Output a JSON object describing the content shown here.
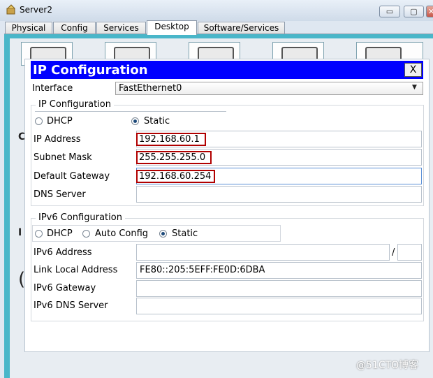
{
  "window": {
    "title": "Server2",
    "min_label": "▭",
    "max_label": "▢",
    "close_label": "✕"
  },
  "tabs": [
    {
      "label": "Physical"
    },
    {
      "label": "Config"
    },
    {
      "label": "Services"
    },
    {
      "label": "Desktop"
    },
    {
      "label": "Software/Services"
    }
  ],
  "background_letters": [
    "C",
    "I",
    "("
  ],
  "dialog": {
    "title": "IP Configuration",
    "close_label": "X",
    "interface_label": "Interface",
    "interface_value": "FastEthernet0",
    "ipv4": {
      "group_title": "IP Configuration",
      "dhcp_label": "DHCP",
      "static_label": "Static",
      "ip_label": "IP Address",
      "ip_value": "192.168.60.1",
      "mask_label": "Subnet Mask",
      "mask_value": "255.255.255.0",
      "gateway_label": "Default Gateway",
      "gateway_value": "192.168.60.254",
      "dns_label": "DNS Server",
      "dns_value": ""
    },
    "ipv6": {
      "group_title": "IPv6 Configuration",
      "dhcp_label": "DHCP",
      "auto_label": "Auto Config",
      "static_label": "Static",
      "address_label": "IPv6 Address",
      "address_value": "",
      "slash": "/",
      "prefix_value": "",
      "link_local_label": "Link Local Address",
      "link_local_value": "FE80::205:5EFF:FE0D:6DBA",
      "gateway_label": "IPv6 Gateway",
      "gateway_value": "",
      "dns_label": "IPv6 DNS Server",
      "dns_value": ""
    }
  },
  "watermark": "@51CTO博客"
}
